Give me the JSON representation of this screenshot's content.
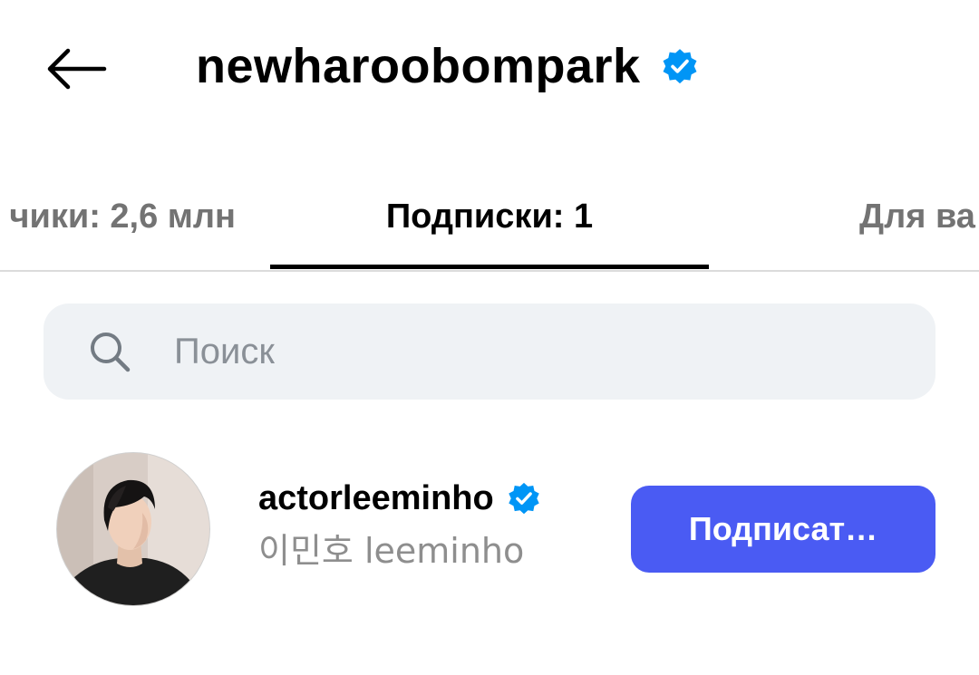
{
  "header": {
    "back_icon": "arrow-left-icon",
    "title": "newharoobompark",
    "verified_icon": "verified-badge-icon"
  },
  "tabs": [
    {
      "label": "чики: 2,6 млн",
      "active": false
    },
    {
      "label": "Подписки: 1",
      "active": true
    },
    {
      "label": "Для ва",
      "active": false
    }
  ],
  "search": {
    "icon": "search-icon",
    "placeholder": "Поиск",
    "value": ""
  },
  "accounts": [
    {
      "username": "actorleeminho",
      "full_name": "이민호 leeminho",
      "verified": true,
      "follow_label": "Подписат…"
    }
  ],
  "colors": {
    "verified": "#0095f6",
    "follow_button": "#4a5bf3",
    "search_bg": "#eff2f5",
    "inactive_tab": "#737373",
    "secondary_text": "#8e8e8e"
  }
}
